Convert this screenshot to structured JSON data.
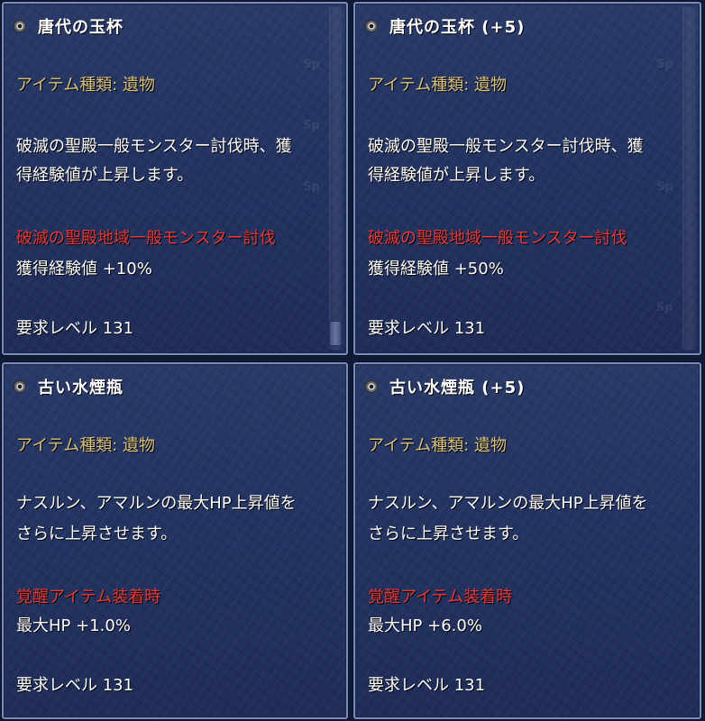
{
  "panels": [
    {
      "title": "唐代の玉杯",
      "item_type": "アイテム種類: 遺物",
      "description_lines": [
        "破滅の聖殿一般モンスター討伐時、獲",
        "得経験値が上昇します。"
      ],
      "effect_title": "破滅の聖殿地域一般モンスター討伐",
      "effect_value": "獲得経験値 +10%",
      "required_level": "要求レベル 131"
    },
    {
      "title": "唐代の玉杯 (+5)",
      "item_type": "アイテム種類: 遺物",
      "description_lines": [
        "破滅の聖殿一般モンスター討伐時、獲",
        "得経験値が上昇します。"
      ],
      "effect_title": "破滅の聖殿地域一般モンスター討伐",
      "effect_value": "獲得経験値 +50%",
      "required_level": "要求レベル 131"
    },
    {
      "title": "古い水煙瓶",
      "item_type": "アイテム種類: 遺物",
      "description_lines": [
        "ナスルン、アマルンの最大HP上昇値を",
        "さらに上昇させます。"
      ],
      "effect_title": "覚醒アイテム装着時",
      "effect_value": "最大HP +1.0%",
      "required_level": "要求レベル 131"
    },
    {
      "title": "古い水煙瓶 (+5)",
      "item_type": "アイテム種類: 遺物",
      "description_lines": [
        "ナスルン、アマルンの最大HP上昇値を",
        "さらに上昇させます。"
      ],
      "effect_title": "覚醒アイテム装着時",
      "effect_value": "最大HP +6.0%",
      "required_level": "要求レベル 131"
    }
  ],
  "colors": {
    "panel_border": "#7a8db8",
    "panel_bg": "#243462",
    "title_text": "#ffffff",
    "item_type_text": "#d9c27e",
    "effect_title_text": "#e63a3a",
    "body_text": "#ffffff"
  },
  "icons": {
    "title_bullet": "item-bullet-icon"
  },
  "watermark_text": "Sp"
}
